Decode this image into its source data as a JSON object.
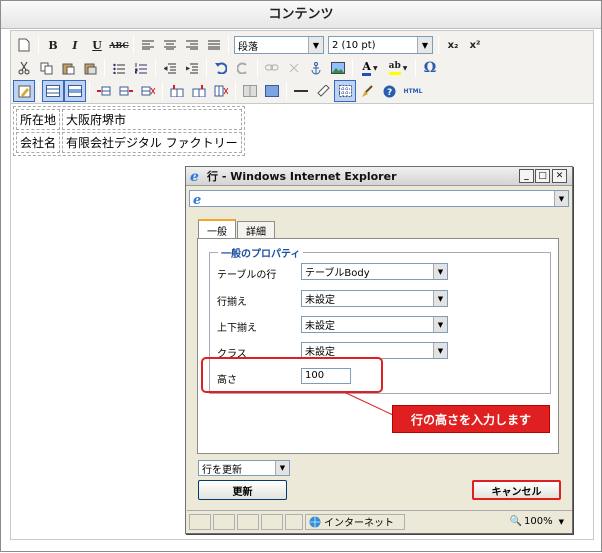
{
  "editor": {
    "title": "コンテンツ",
    "paragraph_style": "段落",
    "font_size": "2 (10 pt)",
    "table": [
      [
        "所在地",
        "大阪府堺市"
      ],
      [
        "会社名",
        "有限会社デジタル ファクトリー"
      ]
    ],
    "html_label": "HTML",
    "superscript_label": "x²",
    "subscript_label": "x₂"
  },
  "dialog": {
    "title": "行 - Windows Internet Explorer",
    "tabs": [
      "一般",
      "詳細"
    ],
    "legend": "一般のプロパティ",
    "fields": [
      {
        "label": "テーブルの行",
        "value": "テーブルBody"
      },
      {
        "label": "行揃え",
        "value": "未設定"
      },
      {
        "label": "上下揃え",
        "value": "未設定"
      },
      {
        "label": "クラス",
        "value": "未設定"
      }
    ],
    "height_label": "高さ",
    "height_value": "100",
    "update_select": "行を更新",
    "update_button": "更新",
    "cancel_button": "キャンセル",
    "status_zone": "インターネット",
    "zoom": "100%"
  },
  "callout": "行の高さを入力します",
  "colors": {
    "callout": "#e02020",
    "accent_tab": "#f5a623"
  }
}
